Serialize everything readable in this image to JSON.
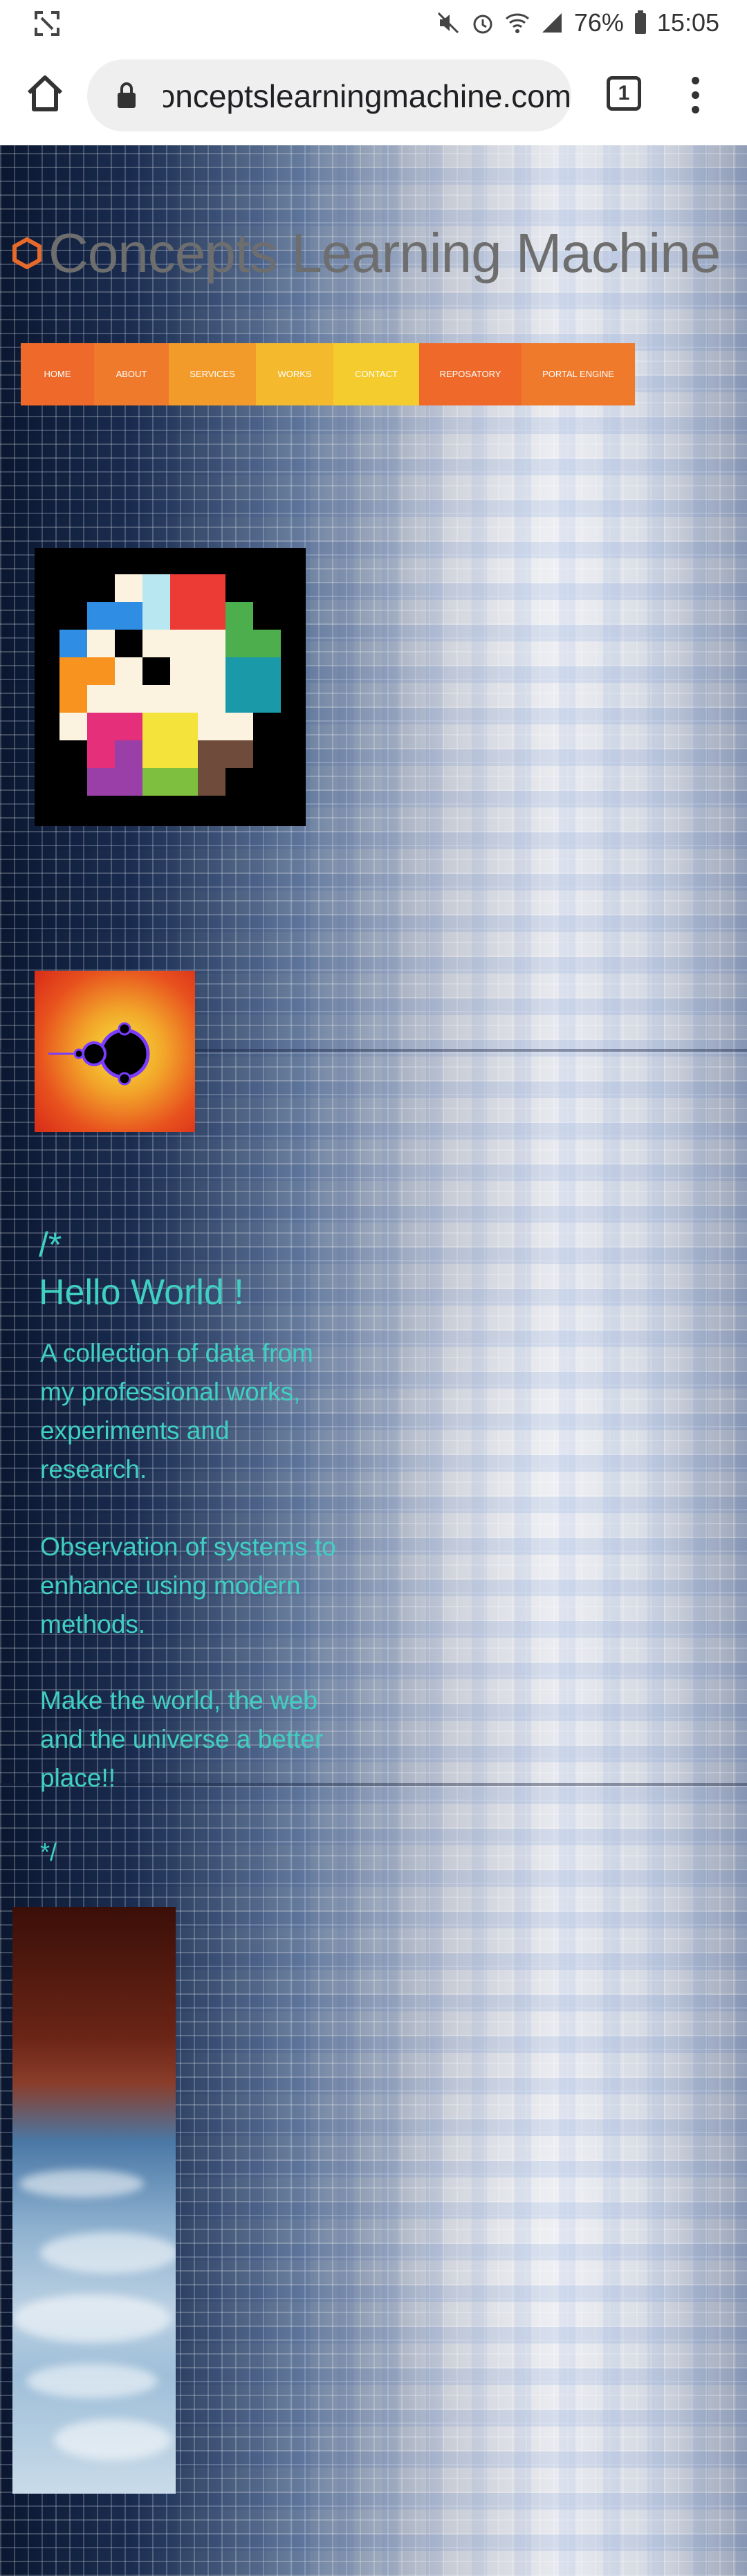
{
  "status_bar": {
    "battery": "76%",
    "time": "15:05"
  },
  "browser": {
    "url": "conceptslearningmachine.com",
    "tab_count": "1"
  },
  "site": {
    "title": "Concepts Learning Machine"
  },
  "nav": {
    "items": [
      {
        "label": "HOME",
        "color": "#ef6a2a"
      },
      {
        "label": "ABOUT",
        "color": "#f07a2c"
      },
      {
        "label": "SERVICES",
        "color": "#f39b2a"
      },
      {
        "label": "WORKS",
        "color": "#f4b92c"
      },
      {
        "label": "CONTACT",
        "color": "#f4cc2e"
      },
      {
        "label": "REPOSATORY",
        "color": "#ef6a2a"
      },
      {
        "label": "PORTAL ENGINE",
        "color": "#f07a2c"
      }
    ]
  },
  "content": {
    "comment_open": "/*",
    "heading": "Hello World !",
    "paragraph_1": "A collection of data from my professional works, experiments and research.",
    "paragraph_2": "Observation of systems to enhance using modern methods.",
    "paragraph_3": "Make the world, the web and the universe a better place!!",
    "comment_close": "*/"
  },
  "colors": {
    "text_accent": "#3fd0c2",
    "title_gray": "#6e6e6e",
    "logo_orange": "#e86a2a"
  }
}
